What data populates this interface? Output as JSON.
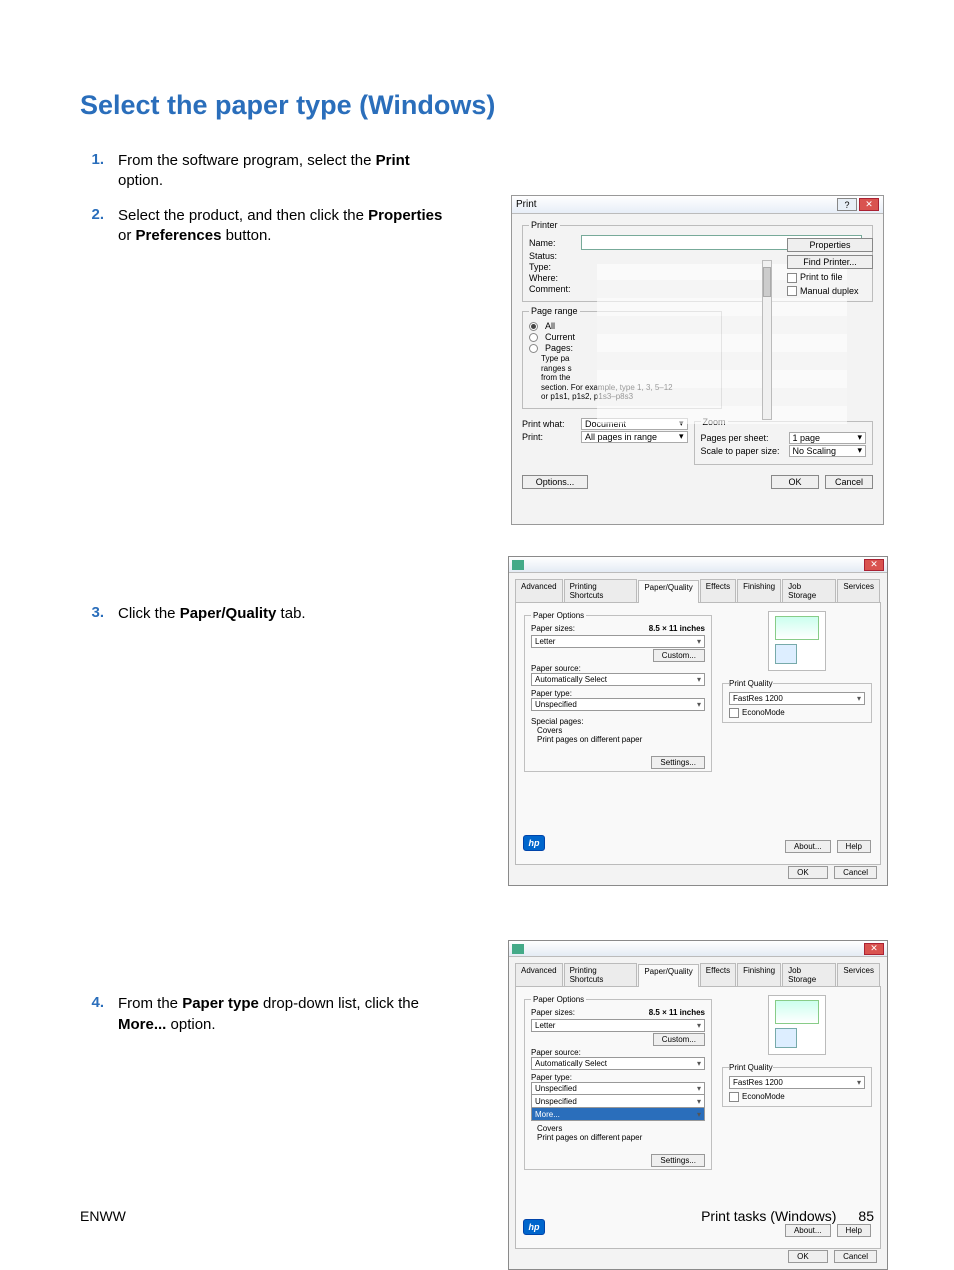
{
  "page": {
    "title": "Select the paper type (Windows)",
    "footer_left": "ENWW",
    "footer_right": "Print tasks (Windows)",
    "page_number": "85"
  },
  "steps": [
    {
      "num": "1.",
      "html": "From the software program, select the <b>Print</b> option."
    },
    {
      "num": "2.",
      "html": "Select the product, and then click the <b>Properties</b> or <b>Preferences</b> button."
    },
    {
      "num": "3.",
      "html": "Click the <b>Paper/Quality</b> tab."
    },
    {
      "num": "4.",
      "html": "From the <b>Paper type</b> drop-down list, click the <b>More...</b> option."
    }
  ],
  "print_dialog": {
    "title": "Print",
    "groups": {
      "printer": "Printer",
      "name": "Name:",
      "status": "Status:",
      "type": "Type:",
      "where": "Where:",
      "comment": "Comment:",
      "page_range": "Page range",
      "all": "All",
      "current": "Current",
      "pages": "Pages:",
      "range_hint1": "Type pa",
      "range_hint2": "ranges s",
      "range_hint3": "from the",
      "range_hint4": "section. For example, type 1, 3, 5–12",
      "range_hint5": "or p1s1, p1s2, p1s3–p8s3",
      "print_what": "Print what:",
      "print": "Print:",
      "print_what_val": "Document",
      "print_val": "All pages in range",
      "zoom": "Zoom",
      "pps": "Pages per sheet:",
      "pps_val": "1 page",
      "scale": "Scale to paper size:",
      "scale_val": "No Scaling"
    },
    "buttons": {
      "properties": "Properties",
      "find_printer": "Find Printer...",
      "print_to_file": "Print to file",
      "manual_duplex": "Manual duplex",
      "options": "Options...",
      "ok": "OK",
      "cancel": "Cancel"
    }
  },
  "prop_dialog": {
    "tabs": [
      "Advanced",
      "Printing Shortcuts",
      "Paper/Quality",
      "Effects",
      "Finishing",
      "Job Storage",
      "Services"
    ],
    "paper_options": "Paper Options",
    "paper_sizes": "Paper sizes:",
    "paper_sizes_dim": "8.5 × 11 inches",
    "paper_sizes_val": "Letter",
    "custom": "Custom...",
    "paper_source": "Paper source:",
    "paper_source_val": "Automatically Select",
    "paper_type": "Paper type:",
    "paper_type_val": "Unspecified",
    "more": "More...",
    "special_pages": "Special pages:",
    "covers": "Covers",
    "diff_paper": "Print pages on different paper",
    "settings": "Settings...",
    "print_quality": "Print Quality",
    "pq_val": "FastRes 1200",
    "economode": "EconoMode",
    "about": "About...",
    "help": "Help",
    "ok": "OK",
    "cancel": "Cancel"
  }
}
